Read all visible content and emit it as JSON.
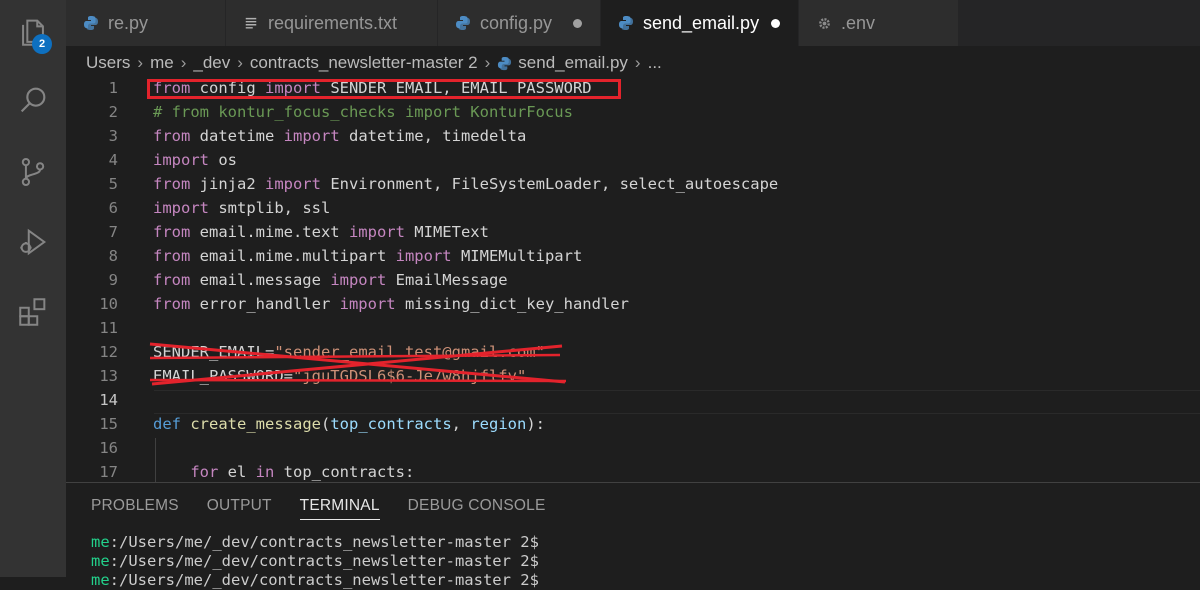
{
  "activity_bar": {
    "items": [
      {
        "name": "explorer",
        "icon": "files-icon",
        "badge": "2"
      },
      {
        "name": "search",
        "icon": "search-icon"
      },
      {
        "name": "source-control",
        "icon": "source-control-icon"
      },
      {
        "name": "run-debug",
        "icon": "run-debug-icon"
      },
      {
        "name": "extensions",
        "icon": "extensions-icon"
      }
    ]
  },
  "tabs": [
    {
      "label": "re.py",
      "icon": "python-icon",
      "modified": false,
      "active": false
    },
    {
      "label": "requirements.txt",
      "icon": "text-file-icon",
      "modified": false,
      "active": false
    },
    {
      "label": "config.py",
      "icon": "python-icon",
      "modified": true,
      "active": false
    },
    {
      "label": "send_email.py",
      "icon": "python-icon",
      "modified": true,
      "active": true
    },
    {
      "label": ".env",
      "icon": "gear-icon",
      "modified": false,
      "active": false
    }
  ],
  "breadcrumb": {
    "parts": [
      "Users",
      "me",
      "_dev",
      "contracts_newsletter-master 2",
      "send_email.py",
      "..."
    ]
  },
  "editor": {
    "line_numbers": [
      "1",
      "2",
      "3",
      "4",
      "5",
      "6",
      "7",
      "8",
      "9",
      "10",
      "11",
      "12",
      "13",
      "14",
      "15",
      "16",
      "17"
    ],
    "current_line": "14",
    "lines": {
      "l1": [
        "from",
        " config ",
        "import",
        " SENDER_EMAIL, EMAIL_PASSWORD"
      ],
      "l2": [
        "# from kontur_focus_checks import KonturFocus"
      ],
      "l3": [
        "from",
        " datetime ",
        "import",
        " datetime, timedelta"
      ],
      "l4": [
        "import",
        " os"
      ],
      "l5": [
        "from",
        " jinja2 ",
        "import",
        " Environment, FileSystemLoader, select_autoescape"
      ],
      "l6": [
        "import",
        " smtplib, ssl"
      ],
      "l7": [
        "from",
        " email.mime.text ",
        "import",
        " MIMEText"
      ],
      "l8": [
        "from",
        " email.mime.multipart ",
        "import",
        " MIMEMultipart"
      ],
      "l9": [
        "from",
        " email.message ",
        "import",
        " EmailMessage"
      ],
      "l10": [
        "from",
        " error_handller ",
        "import",
        " missing_dict_key_handler"
      ],
      "l12": [
        "SENDER_EMAIL=",
        "\"sender_email_test@gmail.com\""
      ],
      "l13": [
        "EMAIL_PASSWORD=",
        "\"jguTGDSL6$6-Je7w8hjflfv\""
      ],
      "l15": [
        "def",
        " ",
        "create_message",
        "(",
        "top_contracts",
        ", ",
        "region",
        "):"
      ],
      "l17": [
        "    ",
        "for",
        " el ",
        "in",
        " top_contracts:"
      ]
    }
  },
  "panel": {
    "tabs": [
      {
        "label": "PROBLEMS",
        "active": false
      },
      {
        "label": "OUTPUT",
        "active": false
      },
      {
        "label": "TERMINAL",
        "active": true
      },
      {
        "label": "DEBUG CONSOLE",
        "active": false
      }
    ],
    "terminal_lines": [
      {
        "prompt": "me",
        "path": ":/Users/me/_dev/contracts_newsletter-master 2$"
      },
      {
        "prompt": "me",
        "path": ":/Users/me/_dev/contracts_newsletter-master 2$"
      },
      {
        "prompt": "me",
        "path": ":/Users/me/_dev/contracts_newsletter-master 2$"
      }
    ]
  },
  "colors": {
    "keyword": "#c586c0",
    "comment": "#6a9955",
    "string": "#ce9178",
    "function": "#dcdcaa",
    "parameter": "#9cdcfe",
    "annotation_red": "#e3232c",
    "badge": "#0e70c0"
  }
}
